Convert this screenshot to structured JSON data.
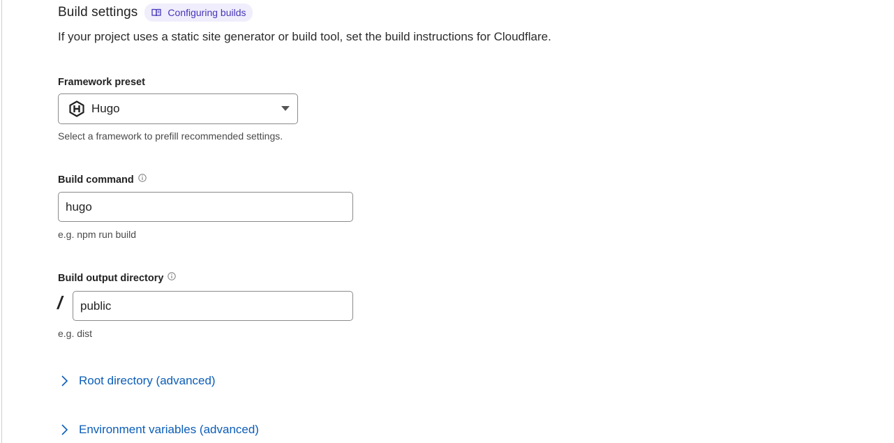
{
  "build_settings": {
    "title": "Build settings",
    "doc_link": {
      "label": "Configuring builds",
      "icon": "book-icon"
    },
    "description": "If your project uses a static site generator or build tool, set the build instructions for Cloudflare."
  },
  "framework_preset": {
    "label": "Framework preset",
    "selected": "Hugo",
    "selected_icon": "hugo-logo-icon",
    "help": "Select a framework to prefill recommended settings."
  },
  "build_command": {
    "label": "Build command",
    "info_icon": "info-icon",
    "value": "hugo",
    "help": "e.g. npm run build"
  },
  "output_directory": {
    "label": "Build output directory",
    "info_icon": "info-icon",
    "prefix": "/",
    "value": "public",
    "help": "e.g. dist"
  },
  "advanced": {
    "root_directory": "Root directory (advanced)",
    "environment_variables": "Environment variables (advanced)"
  },
  "colors": {
    "link": "#0b5db8",
    "chip_bg": "#f0eefc",
    "chip_text": "#4535b8",
    "border": "#8a8a8a"
  }
}
